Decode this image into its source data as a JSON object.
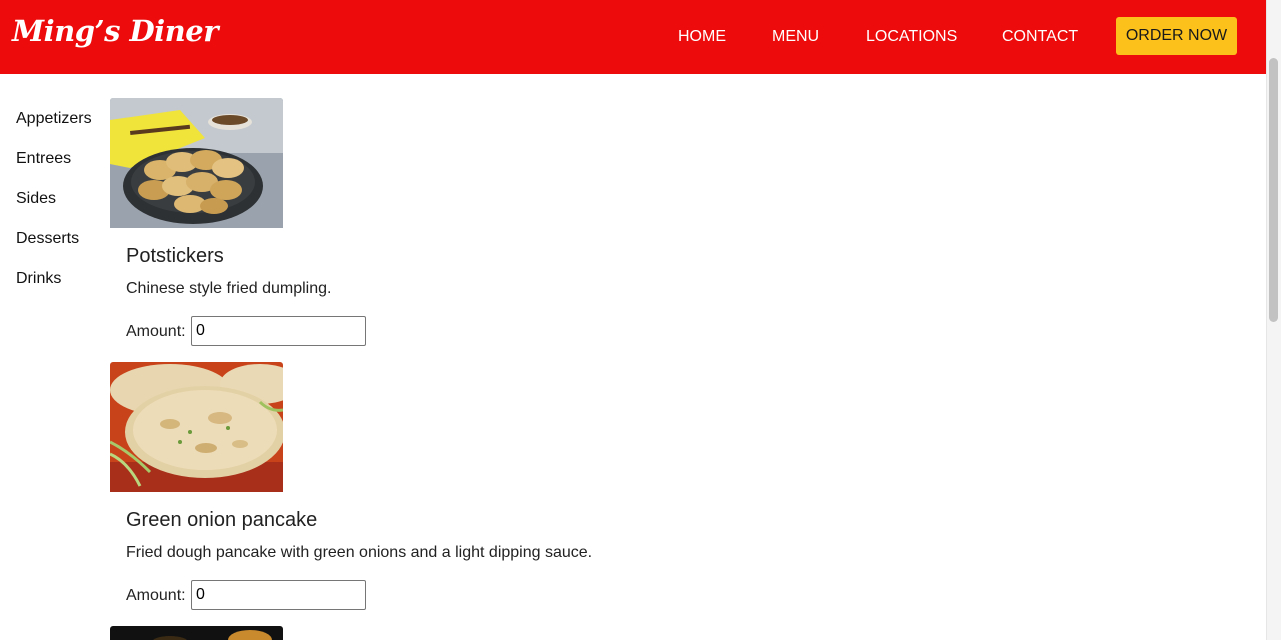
{
  "brand": {
    "name": "Ming’s Diner"
  },
  "nav": {
    "home": "HOME",
    "menu": "MENU",
    "locations": "LOCATIONS",
    "contact": "CONTACT",
    "order_now": "ORDER NOW"
  },
  "colors": {
    "header": "#ee0b0b",
    "order_button": "#fcc11b"
  },
  "sidebar": {
    "items": [
      {
        "label": "Appetizers"
      },
      {
        "label": "Entrees"
      },
      {
        "label": "Sides"
      },
      {
        "label": "Desserts"
      },
      {
        "label": "Drinks"
      }
    ]
  },
  "menu_items": [
    {
      "title": "Potstickers",
      "description": "Chinese style fried dumpling.",
      "amount_label": "Amount:",
      "amount_value": "0"
    },
    {
      "title": "Green onion pancake",
      "description": "Fried dough pancake with green onions and a light dipping sauce.",
      "amount_label": "Amount:",
      "amount_value": "0"
    }
  ]
}
